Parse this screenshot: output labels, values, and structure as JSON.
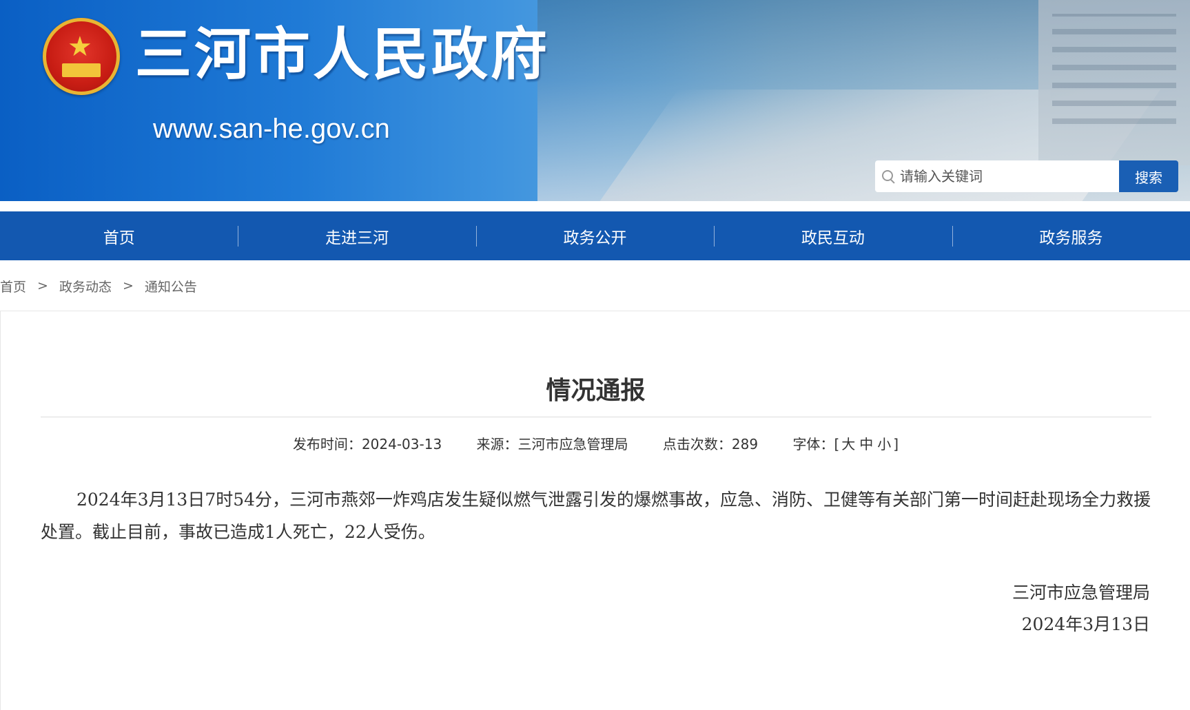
{
  "header": {
    "site_title": "三河市人民政府",
    "site_url": "www.san-he.gov.cn",
    "search_placeholder": "请输入关键词",
    "search_button": "搜索"
  },
  "nav": {
    "items": [
      {
        "label": "首页"
      },
      {
        "label": "走进三河"
      },
      {
        "label": "政务公开"
      },
      {
        "label": "政民互动"
      },
      {
        "label": "政务服务"
      }
    ]
  },
  "breadcrumb": {
    "items": [
      {
        "label": "首页"
      },
      {
        "label": "政务动态"
      },
      {
        "label": "通知公告"
      }
    ],
    "separator": ">"
  },
  "article": {
    "title": "情况通报",
    "meta": {
      "publish_label": "发布时间：",
      "publish_date": "2024-03-13",
      "source_label": "来源：",
      "source": "三河市应急管理局",
      "clicks_label": "点击次数：",
      "clicks": "289",
      "font_label": "字体：",
      "font_open": "[",
      "font_large": "大",
      "font_medium": "中",
      "font_small": "小",
      "font_close": "]"
    },
    "body": "2024年3月13日7时54分，三河市燕郊一炸鸡店发生疑似燃气泄露引发的爆燃事故，应急、消防、卫健等有关部门第一时间赶赴现场全力救援处置。截止目前，事故已造成1人死亡，22人受伤。",
    "signature": "三河市应急管理局",
    "sign_date": "2024年3月13日"
  },
  "colors": {
    "nav_bg": "#1358b0",
    "search_button_bg": "#1a5fb4",
    "banner_blue": "#1f7ad6"
  }
}
